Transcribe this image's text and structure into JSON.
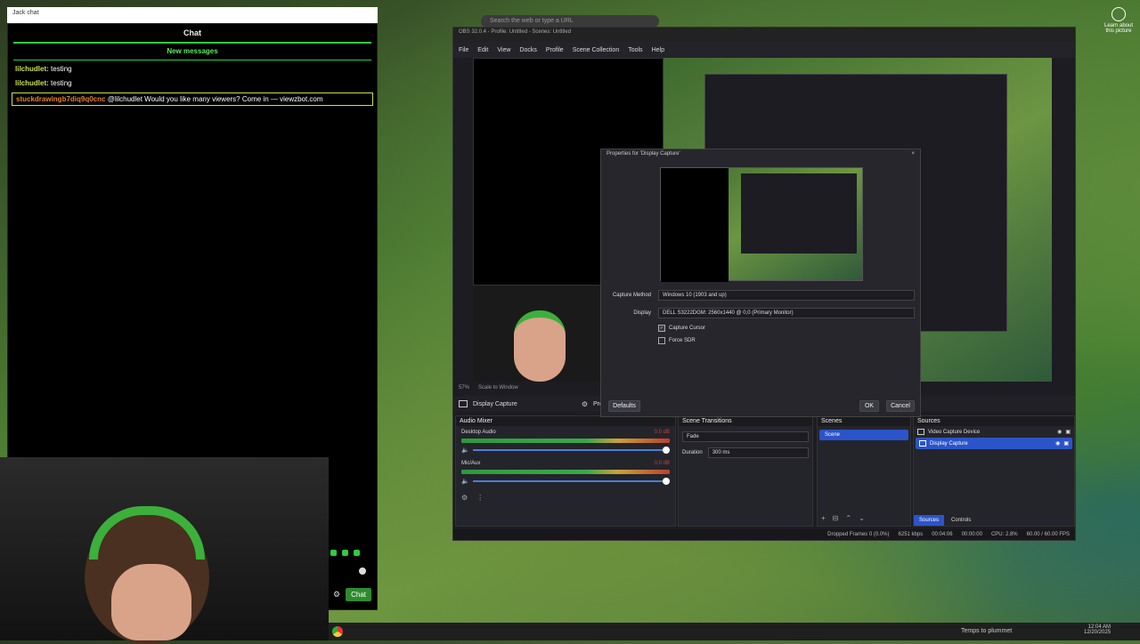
{
  "chat": {
    "tab_title": "Jack chat",
    "header": "Chat",
    "new_messages": "New messages",
    "messages": [
      {
        "user": "lilchudlet:",
        "text": "testing"
      },
      {
        "user": "lilchudlet:",
        "text": "testing"
      },
      {
        "user": "stuckdrawingb7diq9q0cnc",
        "text": "@lilchudlet Would you like many viewers? Come in — viewzbot.com"
      }
    ],
    "chat_button": "Chat"
  },
  "browser": {
    "search_placeholder": "Search the web or type a URL"
  },
  "obs": {
    "title": "OBS 32.0.4 - Profile: Untitled - Scenes: Untitled",
    "menu": [
      "File",
      "Edit",
      "View",
      "Docks",
      "Profile",
      "Scene Collection",
      "Tools",
      "Help"
    ],
    "preview_zoom": "57%",
    "scale_mode": "Scale to Window",
    "source_bar": {
      "source": "Display Capture",
      "properties": "Properties"
    },
    "audio_mixer": {
      "title": "Audio Mixer",
      "channels": [
        {
          "name": "Desktop Audio",
          "level": "0.0 dB",
          "fill": 0.0
        },
        {
          "name": "Mic/Aux",
          "level": "0.0 dB",
          "fill": 0.28
        }
      ],
      "scale": [
        "-60",
        "-55",
        "-50",
        "-45",
        "-40",
        "-35",
        "-30",
        "-25",
        "-20",
        "-15",
        "-10",
        "-5",
        "0"
      ]
    },
    "transitions": {
      "title": "Scene Transitions",
      "type": "Fade",
      "duration_label": "Duration",
      "duration": "300 ms"
    },
    "scenes": {
      "title": "Scenes",
      "items": [
        "Scene"
      ]
    },
    "sources": {
      "title": "Sources",
      "items": [
        "Video Capture Device",
        "Display Capture"
      ]
    },
    "tabs": [
      "Sources",
      "Controls"
    ],
    "status": {
      "dropped": "Dropped Frames 0 (0.0%)",
      "kbps": "6251 kbps",
      "time": "00:04:06",
      "rec": "00:00:00",
      "cpu": "CPU: 2.8%",
      "fps": "60.00 / 60.00 FPS"
    }
  },
  "dialog": {
    "title": "Properties for 'Display Capture'",
    "capture_method_label": "Capture Method",
    "capture_method": "Windows 10 (1903 and up)",
    "display_label": "Display",
    "display": "DELL S3222DGM: 2560x1440 @ 0,0 (Primary Monitor)",
    "capture_cursor": "Capture Cursor",
    "force_sdr": "Force SDR",
    "defaults": "Defaults",
    "ok": "OK",
    "cancel": "Cancel"
  },
  "taskbar": {
    "weather": "Temps to plummet",
    "time": "12:04 AM",
    "date": "12/20/2025"
  },
  "corner": {
    "line1": "Learn about",
    "line2": "this picture"
  }
}
